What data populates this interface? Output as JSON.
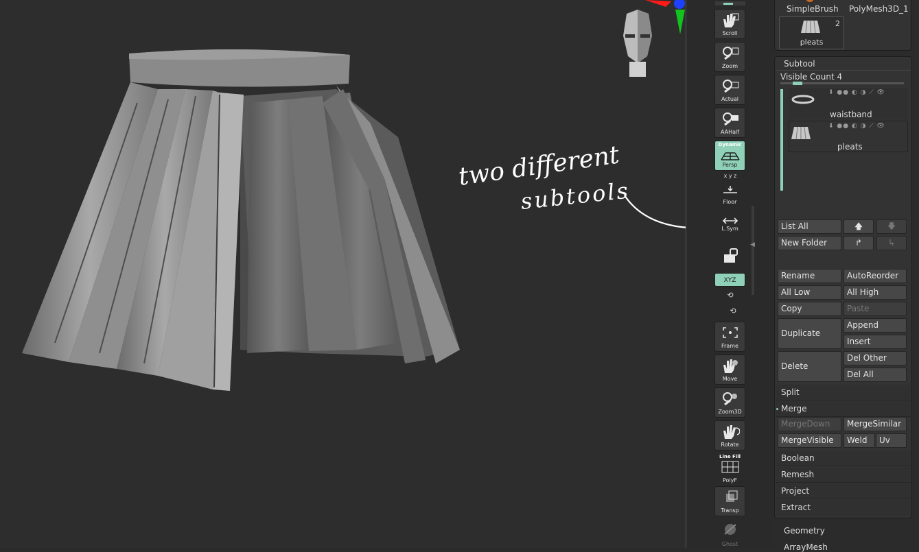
{
  "viewport": {
    "annotation_line1": "two different",
    "annotation_line2": "subtools"
  },
  "shelf": {
    "buttons": [
      {
        "label": "Scroll",
        "icon": "scroll-hand-icon"
      },
      {
        "label": "Zoom",
        "icon": "zoom-magnifier-icon"
      },
      {
        "label": "Actual",
        "icon": "actual-magnifier-icon"
      },
      {
        "label": "AAHalf",
        "icon": "aahalf-magnifier-icon"
      },
      {
        "label": "Persp",
        "top_label": "Dynamic",
        "icon": "perspective-grid-icon",
        "active": true
      },
      {
        "label": "Floor",
        "icon": "floor-icon"
      },
      {
        "label": "L.Sym",
        "icon": "local-symmetry-icon"
      },
      {
        "label": "",
        "icon": "lock-camera-icon"
      },
      {
        "label": "XYZ",
        "icon": "xyz-rotate-icon",
        "active": true
      },
      {
        "label": "",
        "icon": "y-rotate-icon"
      },
      {
        "label": "",
        "icon": "z-rotate-icon"
      },
      {
        "label": "Frame",
        "icon": "frame-icon"
      },
      {
        "label": "Move",
        "icon": "move-hand-icon"
      },
      {
        "label": "Zoom3D",
        "icon": "zoom3d-icon"
      },
      {
        "label": "Rotate",
        "icon": "rotate-icon"
      },
      {
        "label": "PolyF",
        "top_label": "Line Fill",
        "icon": "polyframe-grid-icon"
      },
      {
        "label": "Transp",
        "icon": "transparency-icon"
      },
      {
        "label": "Ghost",
        "icon": "ghost-icon"
      }
    ]
  },
  "tool_palette": {
    "top_tools": {
      "simple_brush": "SimpleBrush",
      "polymesh": "PolyMesh3D_1",
      "pleats_thumb_label": "pleats",
      "pleats_thumb_count": "2"
    },
    "subtool": {
      "title": "Subtool",
      "visible_count": "Visible Count 4",
      "items": [
        {
          "name": "waistband"
        },
        {
          "name": "pleats"
        }
      ],
      "buttons": {
        "list_all": "List All",
        "new_folder": "New Folder",
        "rename": "Rename",
        "auto_reorder": "AutoReorder",
        "all_low": "All Low",
        "all_high": "All High",
        "copy": "Copy",
        "paste": "Paste",
        "duplicate": "Duplicate",
        "append": "Append",
        "insert": "Insert",
        "delete": "Delete",
        "del_other": "Del Other",
        "del_all": "Del All",
        "split": "Split",
        "merge": "Merge",
        "merge_down": "MergeDown",
        "merge_similar": "MergeSimilar",
        "merge_visible": "MergeVisible",
        "weld": "Weld",
        "uv": "Uv",
        "boolean": "Boolean",
        "remesh": "Remesh",
        "project": "Project",
        "extract": "Extract"
      }
    },
    "geometry": "Geometry",
    "array_mesh": "ArrayMesh"
  },
  "colors": {
    "accent": "#8fd0b8",
    "viewport_bg": "#2d2d2d",
    "panel_bg": "#333333",
    "button_bg": "#474747"
  }
}
